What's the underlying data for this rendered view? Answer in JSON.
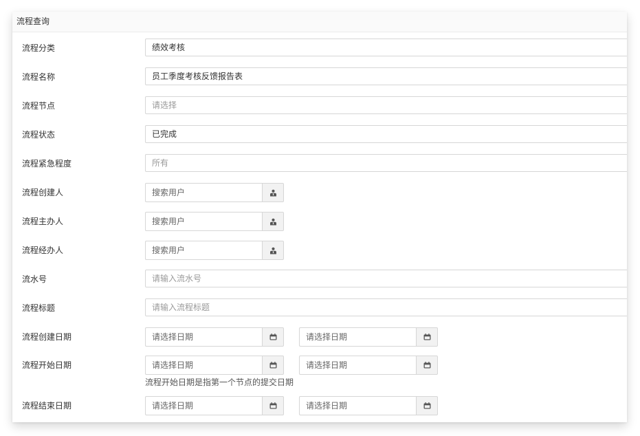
{
  "panel": {
    "title": "流程查询"
  },
  "fields": {
    "category": {
      "label": "流程分类",
      "value": "绩效考核"
    },
    "name": {
      "label": "流程名称",
      "value": "员工季度考核反馈报告表"
    },
    "node": {
      "label": "流程节点",
      "placeholder": "请选择"
    },
    "status": {
      "label": "流程状态",
      "value": "已完成"
    },
    "urgency": {
      "label": "流程紧急程度",
      "placeholder": "所有"
    },
    "creator": {
      "label": "流程创建人",
      "placeholder": "搜索用户"
    },
    "owner": {
      "label": "流程主办人",
      "placeholder": "搜索用户"
    },
    "handler": {
      "label": "流程经办人",
      "placeholder": "搜索用户"
    },
    "serial": {
      "label": "流水号",
      "placeholder": "请输入流水号"
    },
    "title": {
      "label": "流程标题",
      "placeholder": "请输入流程标题"
    },
    "create_date": {
      "label": "流程创建日期",
      "start_placeholder": "请选择日期",
      "end_placeholder": "请选择日期"
    },
    "start_date": {
      "label": "流程开始日期",
      "start_placeholder": "请选择日期",
      "end_placeholder": "请选择日期",
      "help": "流程开始日期是指第一个节点的提交日期"
    },
    "end_date": {
      "label": "流程结束日期",
      "start_placeholder": "请选择日期",
      "end_placeholder": "请选择日期"
    }
  },
  "icons": {
    "user": "user-icon",
    "calendar": "calendar-icon"
  },
  "colors": {
    "border": "#d6d6d6",
    "addon_bg": "#f2f2f2",
    "placeholder": "#9a9a9a",
    "text": "#333333"
  }
}
